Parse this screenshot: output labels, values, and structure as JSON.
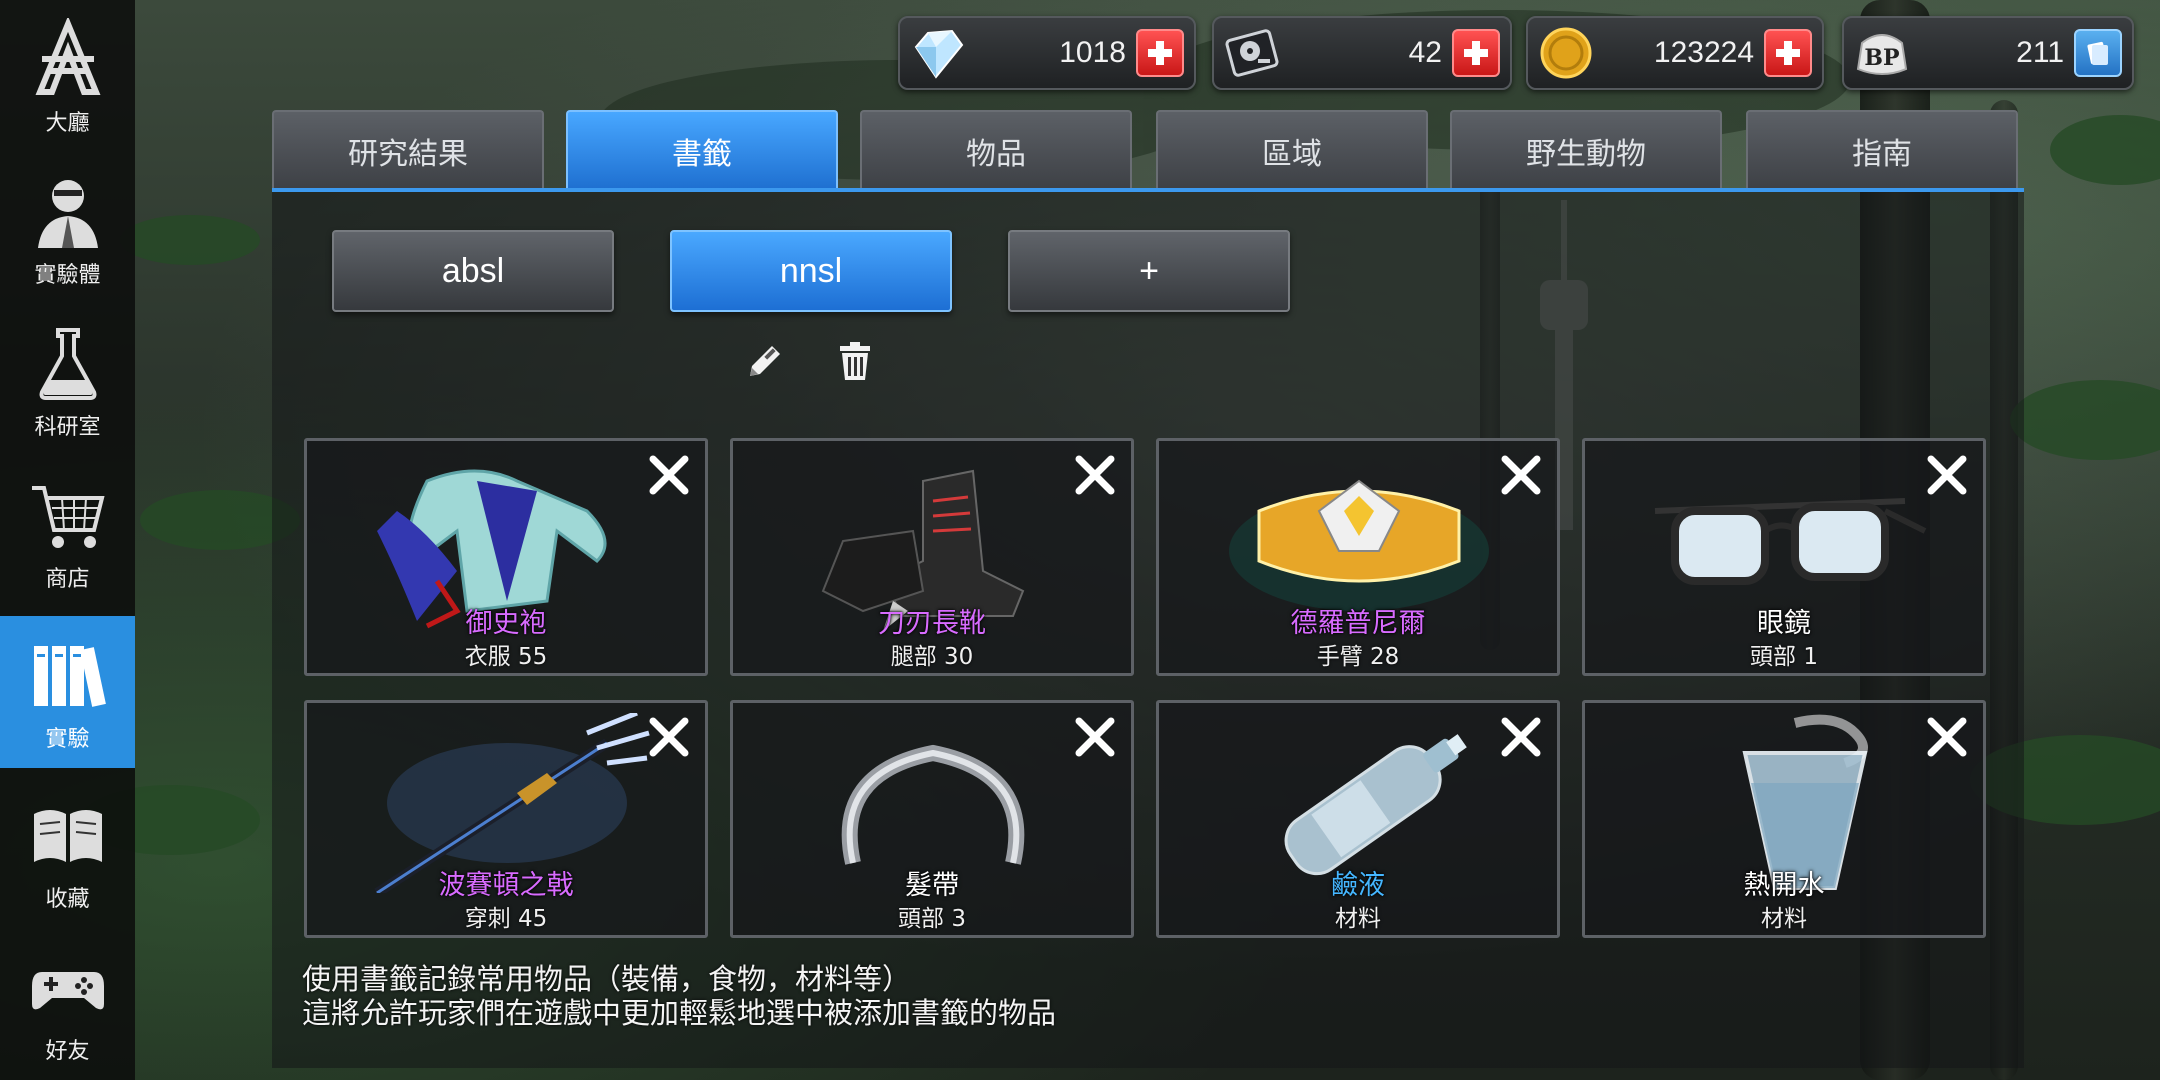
{
  "sidebar": {
    "items": [
      {
        "label": "大廳",
        "icon": "lobby-logo-icon"
      },
      {
        "label": "實驗體",
        "icon": "subject-portrait-icon"
      },
      {
        "label": "科研室",
        "icon": "flask-icon"
      },
      {
        "label": "商店",
        "icon": "shopping-cart-icon"
      },
      {
        "label": "實驗",
        "icon": "books-icon",
        "active": true
      },
      {
        "label": "收藏",
        "icon": "open-book-icon"
      },
      {
        "label": "好友",
        "icon": "gamepad-icon"
      }
    ]
  },
  "currencies": [
    {
      "name": "diamond",
      "value": "1018",
      "action": "plus"
    },
    {
      "name": "disk",
      "value": "42",
      "action": "plus"
    },
    {
      "name": "coin",
      "value": "123224",
      "action": "plus"
    },
    {
      "name": "bp",
      "icon_text": "BP",
      "value": "211",
      "action": "card"
    }
  ],
  "tabs": [
    {
      "label": "研究結果"
    },
    {
      "label": "書籤",
      "active": true
    },
    {
      "label": "物品"
    },
    {
      "label": "區域"
    },
    {
      "label": "野生動物"
    },
    {
      "label": "指南"
    }
  ],
  "bookmarks": {
    "items": [
      {
        "label": "absl"
      },
      {
        "label": "nnsl",
        "active": true
      },
      {
        "label": "+"
      }
    ]
  },
  "items": [
    {
      "name": "御史袍",
      "sub": "衣服 55",
      "rarity": "purple",
      "icon": "robe-icon"
    },
    {
      "name": "刀刃長靴",
      "sub": "腿部 30",
      "rarity": "purple",
      "icon": "boots-icon"
    },
    {
      "name": "德羅普尼爾",
      "sub": "手臂 28",
      "rarity": "purple",
      "icon": "bracelet-icon"
    },
    {
      "name": "眼鏡",
      "sub": "頭部 1",
      "rarity": "white",
      "icon": "glasses-icon"
    },
    {
      "name": "波賽頓之戟",
      "sub": "穿刺 45",
      "rarity": "purple",
      "icon": "trident-icon"
    },
    {
      "name": "髮帶",
      "sub": "頭部 3",
      "rarity": "white",
      "icon": "hairband-icon"
    },
    {
      "name": "鹼液",
      "sub": "材料",
      "rarity": "blue",
      "icon": "bottle-icon"
    },
    {
      "name": "熱開水",
      "sub": "材料",
      "rarity": "white",
      "icon": "hot-water-cup-icon"
    }
  ],
  "description": {
    "line1": "使用書籤記錄常用物品（裝備，食物，材料等）",
    "line2": "這將允許玩家們在遊戲中更加輕鬆地選中被添加書籤的物品"
  },
  "colors": {
    "accent_blue": "#2a8fe0",
    "rarity_purple": "#d86bff",
    "rarity_blue": "#45b6ff",
    "plus_red": "#e02424"
  }
}
